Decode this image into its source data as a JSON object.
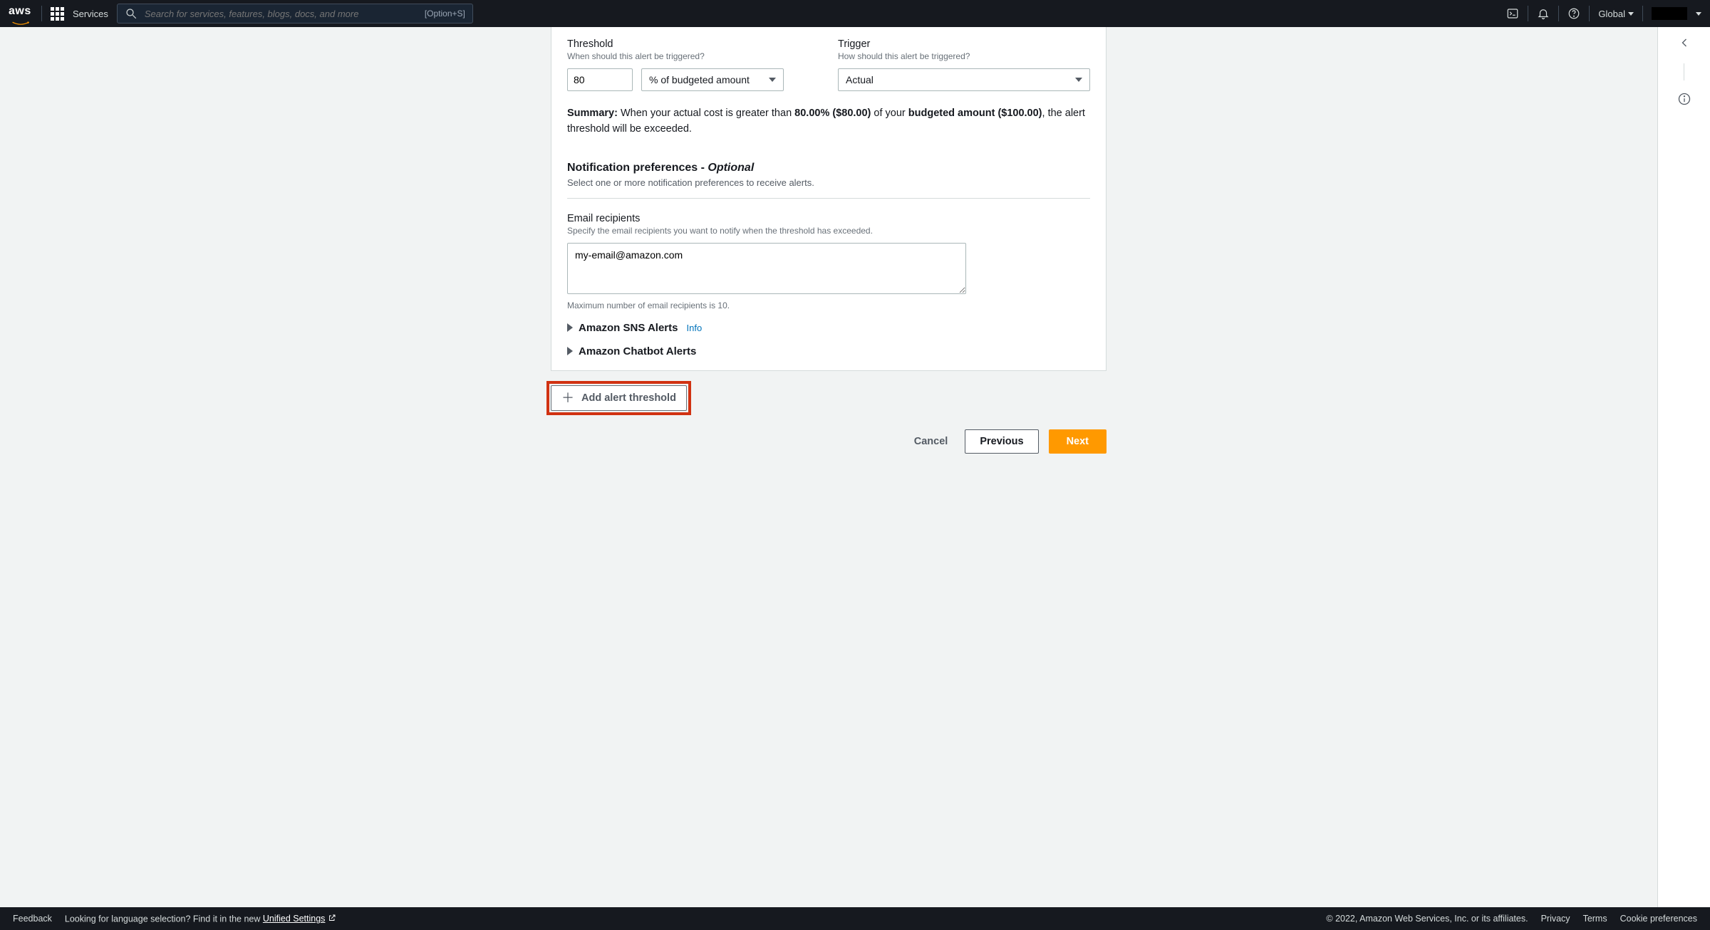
{
  "nav": {
    "logo": "aws",
    "services": "Services",
    "search_placeholder": "Search for services, features, blogs, docs, and more",
    "search_hint": "[Option+S]",
    "region": "Global"
  },
  "threshold": {
    "label": "Threshold",
    "desc": "When should this alert be triggered?",
    "value": "80",
    "unit": "% of budgeted amount"
  },
  "trigger": {
    "label": "Trigger",
    "desc": "How should this alert be triggered?",
    "value": "Actual"
  },
  "summary": {
    "lead": "Summary:",
    "pre": " When your actual cost is greater than ",
    "pct": "80.00% ($80.00)",
    "mid": " of your ",
    "budget": "budgeted amount ($100.00)",
    "tail": ", the alert threshold will be exceeded."
  },
  "notif": {
    "title": "Notification preferences - ",
    "optional": "Optional",
    "desc": "Select one or more notification preferences to receive alerts."
  },
  "email": {
    "label": "Email recipients",
    "desc": "Specify the email recipients you want to notify when the threshold has exceeded.",
    "value": "my-email@amazon.com",
    "hint": "Maximum number of email recipients is 10."
  },
  "expanders": {
    "sns": "Amazon SNS Alerts",
    "sns_info": "Info",
    "chatbot": "Amazon Chatbot Alerts"
  },
  "add_button": "Add alert threshold",
  "actions": {
    "cancel": "Cancel",
    "previous": "Previous",
    "next": "Next"
  },
  "footer": {
    "feedback": "Feedback",
    "lang_prompt": "Looking for language selection? Find it in the new ",
    "unified": "Unified Settings",
    "copyright": "© 2022, Amazon Web Services, Inc. or its affiliates.",
    "privacy": "Privacy",
    "terms": "Terms",
    "cookie": "Cookie preferences"
  }
}
